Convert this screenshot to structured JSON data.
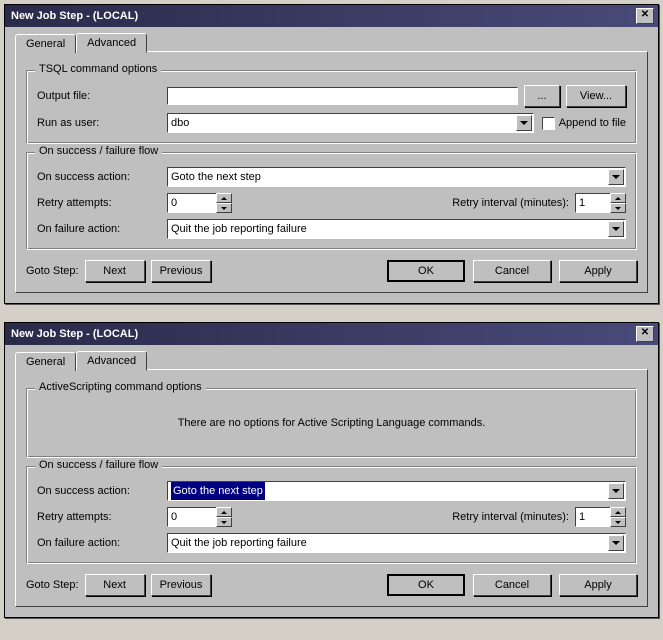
{
  "dialog1": {
    "title": "New Job Step - (LOCAL)",
    "tabs": {
      "general": "General",
      "advanced": "Advanced"
    },
    "tsql": {
      "group_title": "TSQL command options",
      "output_file_label": "Output file:",
      "output_file_value": "",
      "browse": "...",
      "view": "View...",
      "run_as_label": "Run as user:",
      "run_as_value": "dbo",
      "append_label": "Append to file"
    },
    "flow": {
      "group_title": "On success / failure flow",
      "success_label": "On success action:",
      "success_value": "Goto the next step",
      "retry_label": "Retry attempts:",
      "retry_value": "0",
      "interval_label": "Retry interval (minutes):",
      "interval_value": "1",
      "failure_label": "On failure action:",
      "failure_value": "Quit the job reporting failure"
    },
    "buttons": {
      "goto_label": "Goto Step:",
      "next": "Next",
      "previous": "Previous",
      "ok": "OK",
      "cancel": "Cancel",
      "apply": "Apply"
    }
  },
  "dialog2": {
    "title": "New Job Step - (LOCAL)",
    "tabs": {
      "general": "General",
      "advanced": "Advanced"
    },
    "active": {
      "group_title": "ActiveScripting command options",
      "message": "There are no options for Active Scripting Language commands."
    },
    "flow": {
      "group_title": "On success / failure flow",
      "success_label": "On success action:",
      "success_value": "Goto the next step",
      "retry_label": "Retry attempts:",
      "retry_value": "0",
      "interval_label": "Retry interval (minutes):",
      "interval_value": "1",
      "failure_label": "On failure action:",
      "failure_value": "Quit the job reporting failure"
    },
    "buttons": {
      "goto_label": "Goto Step:",
      "next": "Next",
      "previous": "Previous",
      "ok": "OK",
      "cancel": "Cancel",
      "apply": "Apply"
    }
  }
}
